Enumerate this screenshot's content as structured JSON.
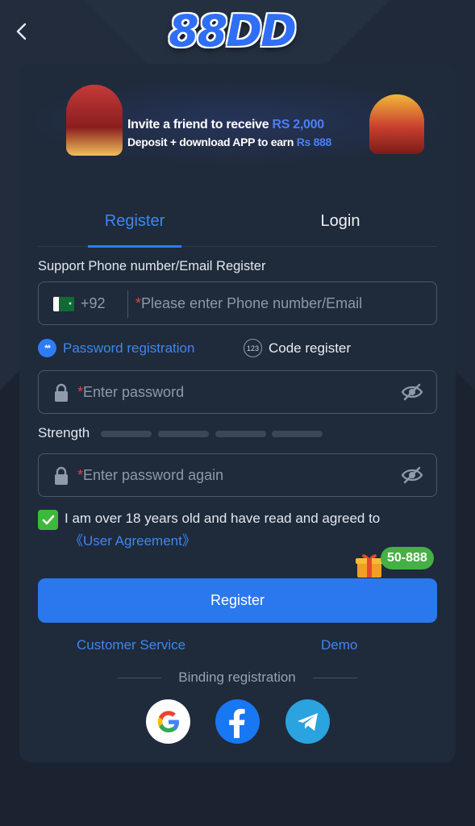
{
  "header": {
    "logo_text": "88DD"
  },
  "banner": {
    "line1_prefix": "Invite a friend to receive ",
    "line1_amount": "RS 2,000",
    "line2_prefix": "Deposit + download APP to earn ",
    "line2_amount": "Rs 888"
  },
  "tabs": [
    {
      "label": "Register",
      "active": true
    },
    {
      "label": "Login",
      "active": false
    }
  ],
  "form": {
    "phone_label": "Support Phone number/Email Register",
    "country_code": "+92",
    "phone_placeholder": "Please enter Phone number/Email",
    "required_mark": "*",
    "option_password": "Password registration",
    "option_password_icon": "**",
    "option_code": "Code register",
    "option_code_icon": "123",
    "password_placeholder": "Enter password",
    "strength_label": "Strength",
    "password_again_placeholder": "Enter password again",
    "agree_text": "I am over 18 years old and have read and agreed to",
    "agree_link": "《User Agreement》",
    "agree_checked": true
  },
  "promo_badge": "50-888",
  "register_button": "Register",
  "links": {
    "customer_service": "Customer Service",
    "demo": "Demo"
  },
  "binding_label": "Binding registration",
  "colors": {
    "accent": "#2b78ee",
    "background": "#1b2331",
    "card": "#1f2a3b",
    "check": "#3cb93b"
  }
}
